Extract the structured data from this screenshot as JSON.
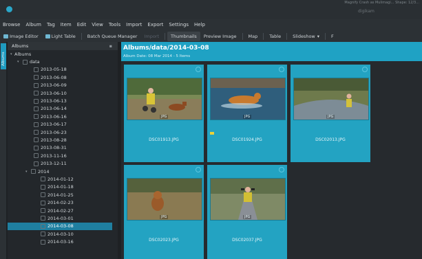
{
  "window": {
    "title": "digikam",
    "title_top": "Magnify Crash as Mulimagi... Shape: 12/3..."
  },
  "menu": [
    "Browse",
    "Album",
    "Tag",
    "Item",
    "Edit",
    "View",
    "Tools",
    "Import",
    "Export",
    "Settings",
    "Help"
  ],
  "toolbar": {
    "image_editor": "Image Editor",
    "light_table": "Light Table",
    "batch_queue": "Batch Queue Manager",
    "import": "Import",
    "thumbnails": "Thumbnails",
    "preview": "Preview Image",
    "map": "Map",
    "table": "Table",
    "slideshow": "Slideshow",
    "overflow": "F"
  },
  "left_tab": "Albums",
  "sidebar": {
    "header": "Albums",
    "root": "Albums",
    "folder": "data",
    "dates": [
      "2013-05-18",
      "2013-06-08",
      "2013-06-09",
      "2013-06-10",
      "2013-06-13",
      "2013-06-14",
      "2013-06-16",
      "2013-06-17",
      "2013-06-23",
      "2013-08-28",
      "2013-08-31",
      "2013-11-16",
      "2013-12-11"
    ],
    "year": "2014",
    "dates_2014": [
      "2014-01-12",
      "2014-01-18",
      "2014-01-25",
      "2014-02-23",
      "2014-02-27",
      "2014-03-01",
      "2014-03-08",
      "2014-03-10",
      "2014-03-16"
    ],
    "selected": "2014-03-08"
  },
  "album": {
    "title": "Albums/data/2014-03-08",
    "subtitle": "Album Date: 08 Mar 2014 - 5 Items"
  },
  "thumbnails": [
    {
      "filename": "DSC01913.JPG",
      "badge": "JPG"
    },
    {
      "filename": "DSC01924.JPG",
      "badge": "JPG"
    },
    {
      "filename": "DSC02013.JPG",
      "badge": "JPG"
    },
    {
      "filename": "DSC02023.JPG",
      "badge": "JPG"
    },
    {
      "filename": "DSC02037.JPG",
      "badge": "JPG"
    }
  ],
  "colors": {
    "accent": "#1fa2c4",
    "selection": "#1f7fa0",
    "background": "#1e2124"
  },
  "icons": [
    "app-icon",
    "image-editor-icon",
    "light-table-icon",
    "batch-queue-icon",
    "import-icon",
    "close-icon",
    "folder-icon",
    "flag-icon"
  ]
}
